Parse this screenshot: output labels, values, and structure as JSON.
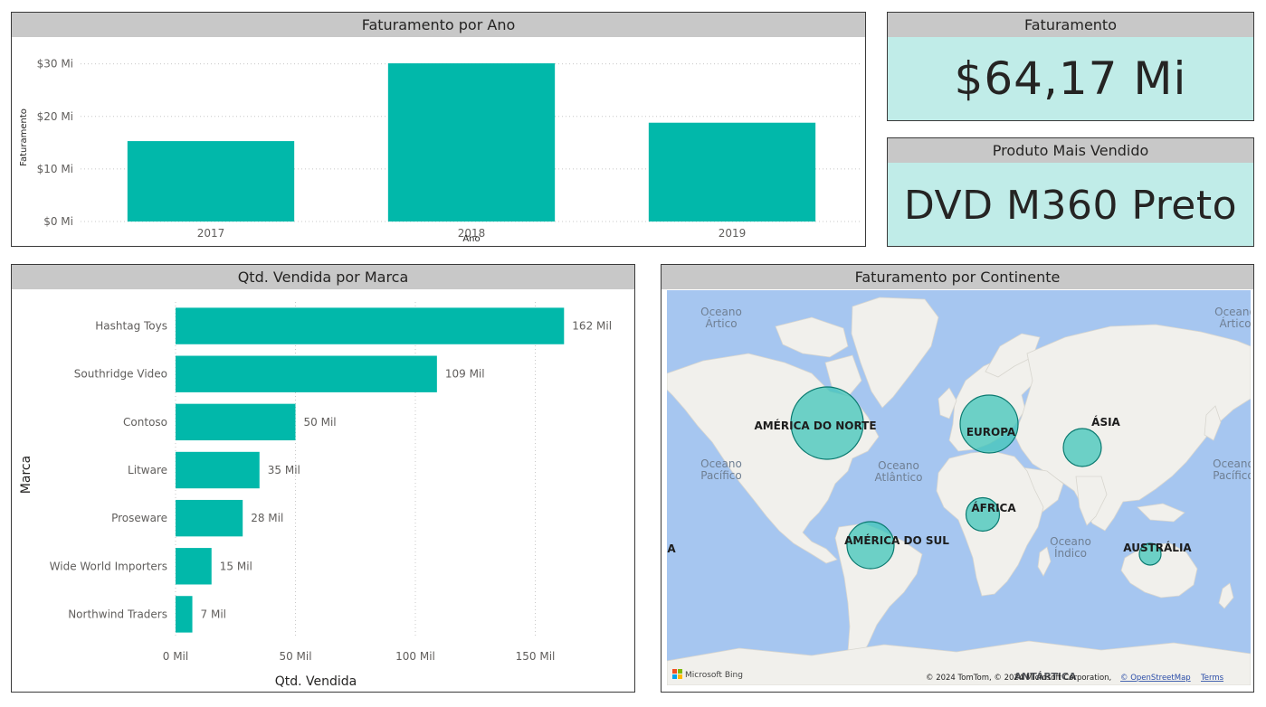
{
  "panels": {
    "revenue_by_year": {
      "title": "Faturamento por Ano"
    },
    "revenue_kpi": {
      "title": "Faturamento",
      "value": "$64,17 Mi"
    },
    "top_product": {
      "title": "Produto Mais Vendido",
      "value": "DVD M360 Preto"
    },
    "qty_by_brand": {
      "title": "Qtd. Vendida por Marca"
    },
    "revenue_by_continent": {
      "title": "Faturamento por Continente"
    }
  },
  "chart_data": [
    {
      "id": "revenue_by_year",
      "type": "bar",
      "categories": [
        "2017",
        "2018",
        "2019"
      ],
      "values": [
        15.3,
        30.1,
        18.8
      ],
      "xlabel": "Ano",
      "ylabel": "Faturamento",
      "yticks": [
        "$0 Mi",
        "$10 Mi",
        "$20 Mi",
        "$30 Mi"
      ],
      "ylim": [
        0,
        32
      ],
      "grid": true,
      "color": "#01b8aa"
    },
    {
      "id": "qty_by_brand",
      "type": "bar",
      "orientation": "horizontal",
      "categories": [
        "Hashtag Toys",
        "Southridge Video",
        "Contoso",
        "Litware",
        "Proseware",
        "Wide World Importers",
        "Northwind Traders"
      ],
      "values": [
        162,
        109,
        50,
        35,
        28,
        15,
        7
      ],
      "data_labels": [
        "162 Mil",
        "109 Mil",
        "50 Mil",
        "35 Mil",
        "28 Mil",
        "15 Mil",
        "7 Mil"
      ],
      "xlabel": "Qtd. Vendida",
      "ylabel": "Marca",
      "xticks": [
        "0 Mil",
        "50 Mil",
        "100 Mil",
        "150 Mil"
      ],
      "xlim": [
        0,
        190
      ],
      "grid": true,
      "color": "#01b8aa"
    }
  ],
  "map": {
    "bubble_color": "#3fc6b9",
    "bubble_stroke": "#0b7a70",
    "land_color": "#f1f0ec",
    "water_color": "#a6c6f0",
    "continents": [
      {
        "name": "AMÉRICA DO NORTE"
      },
      {
        "name": "EUROPA"
      },
      {
        "name": "ÁSIA"
      },
      {
        "name": "ÁFRICA"
      },
      {
        "name": "AMÉRICA DO SUL"
      },
      {
        "name": "AUSTRÁLIA"
      }
    ],
    "oceans": {
      "arctic_left": [
        "Oceano",
        "Ártico"
      ],
      "arctic_right": [
        "Oceano",
        "Ártico"
      ],
      "pacific_left": [
        "Oceano",
        "Pacífico"
      ],
      "pacific_right": [
        "Oceano",
        "Pacífico"
      ],
      "atlantic": [
        "Oceano",
        "Atlântico"
      ],
      "indian": [
        "Oceano",
        "Índico"
      ]
    },
    "edge_label": "A",
    "antarctica_label": "ANTÁRTICA",
    "bing_label": "Microsoft Bing",
    "attribution": "© 2024 TomTom, © 2024 Microsoft Corporation,",
    "osm_link": "© OpenStreetMap",
    "terms_link": "Terms"
  }
}
